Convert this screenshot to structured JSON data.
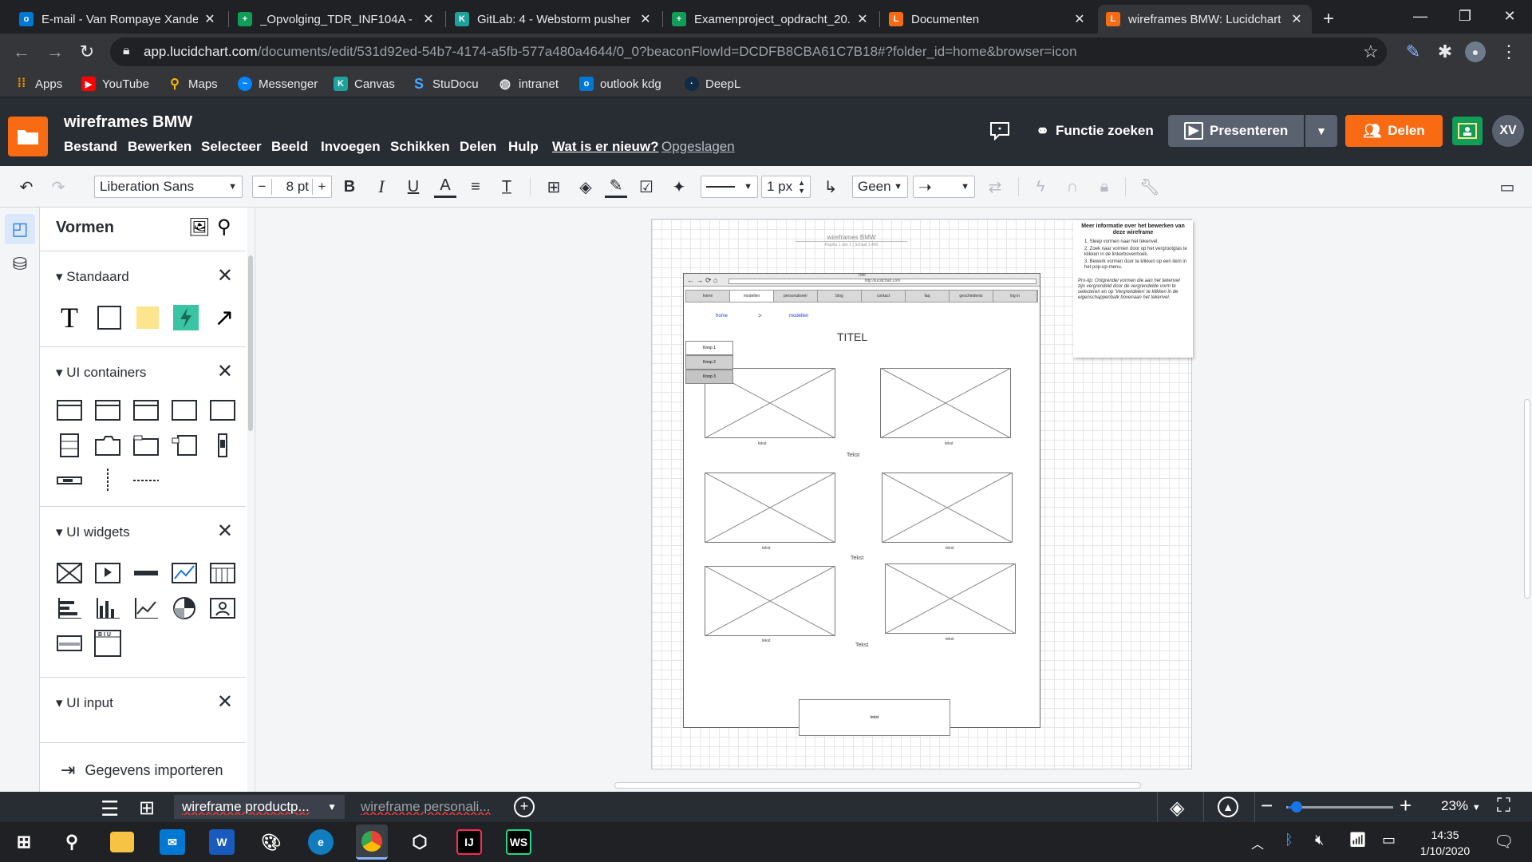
{
  "browser": {
    "tabs": [
      {
        "title": "E-mail - Van Rompaye Xande",
        "icon": "outlook-icon",
        "color": "#0078d4"
      },
      {
        "title": "_Opvolging_TDR_INF104A - G",
        "icon": "sheets-icon",
        "color": "#0f9d58"
      },
      {
        "title": "GitLab: 4 - Webstorm pusher",
        "icon": "gitlab-k-icon",
        "color": "#1ba39c"
      },
      {
        "title": "Examenproject_opdracht_20...",
        "icon": "sheets-icon",
        "color": "#0f9d58"
      },
      {
        "title": "Documenten",
        "icon": "lucid-icon",
        "color": "#f96b13"
      },
      {
        "title": "wireframes BMW: Lucidchart",
        "icon": "lucid-icon",
        "color": "#f96b13"
      }
    ],
    "url_host": "app.lucidchart.com",
    "url_path": "/documents/edit/531d92ed-54b7-4174-a5fb-577a480a4644/0_0?beaconFlowId=DCDFB8CBA61C7B18#?folder_id=home&browser=icon",
    "bookmarks": [
      "Apps",
      "YouTube",
      "Maps",
      "Messenger",
      "Canvas",
      "StuDocu",
      "intranet",
      "outlook kdg",
      "DeepL"
    ]
  },
  "lucid": {
    "doc_title": "wireframes BMW",
    "menu": [
      "Bestand",
      "Bewerken",
      "Selecteer",
      "Beeld",
      "Invoegen",
      "Schikken",
      "Delen",
      "Hulp"
    ],
    "whats_new": "Wat is er nieuw?",
    "saved": "Opgeslagen",
    "find_features": "Functie zoeken",
    "present": "Presenteren",
    "share": "Delen",
    "avatar": "XV"
  },
  "toolbar": {
    "font": "Liberation Sans",
    "font_size": "8 pt",
    "line_width": "1 px",
    "endpoint": "Geen"
  },
  "shapes_panel": {
    "title": "Vormen",
    "sections": [
      "Standaard",
      "UI containers",
      "UI widgets",
      "UI input"
    ],
    "import": "Gegevens importeren"
  },
  "wireframe": {
    "header_title": "wireframes BMW",
    "header_sub": "Pagina 1 van 1 | Schaal 1:400",
    "browser_url": "http://lucidchart.com",
    "browser_title": "Titel",
    "nav": [
      "home",
      "modellen",
      "personaliseer",
      "blog",
      "contact",
      "faq",
      "geschiedenis",
      "log in"
    ],
    "breadcrumb_home": "home",
    "breadcrumb_sep": ">",
    "breadcrumb_current": "modellen",
    "page_title": "TITEL",
    "menu_items": [
      "Knop 1",
      "Knop 2",
      "Knop 3"
    ],
    "caption": "tekst",
    "row_text": "Tekst",
    "footer_box": "tekst"
  },
  "info_note": {
    "title": "Meer informatie over het bewerken van deze wireframe",
    "lines": [
      "1. Sleep vormen naar het tekenvel.",
      "2. Zoek naar vormen door op het vergrootglas te klikken in de linkerbovenhoek.",
      "3. Bewerk vormen door te klikken op een item in het pop-up-menu.",
      "Pro-tip: Ontgrendel vormen die aan het tekenvel zijn vergrendeld door de vergrendelde vorm te selecteren en op 'Vergrendelen' te klikken in de eigenschappenbalk bovenaan het tekenvel."
    ]
  },
  "bottom": {
    "pages": [
      "wireframe productp...",
      "wireframe personali..."
    ],
    "zoom": "23%"
  },
  "taskbar": {
    "time": "14:35",
    "date": "1/10/2020"
  }
}
